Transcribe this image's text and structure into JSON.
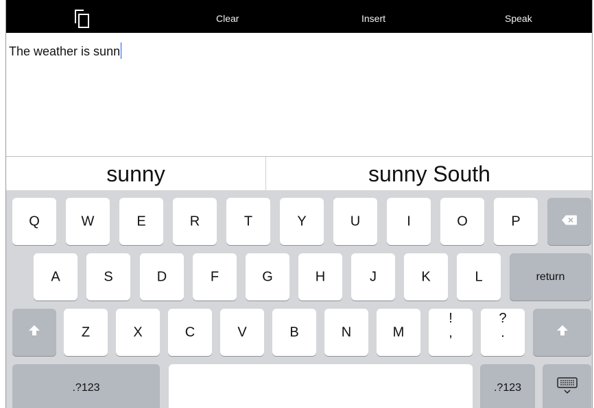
{
  "toolbar": {
    "copy_icon": "copy-icon",
    "clear_label": "Clear",
    "insert_label": "Insert",
    "speak_label": "Speak"
  },
  "editor": {
    "text": "The weather is sunn"
  },
  "suggestions": [
    "sunny",
    "sunny South"
  ],
  "keyboard": {
    "row1": [
      "Q",
      "W",
      "E",
      "R",
      "T",
      "Y",
      "U",
      "I",
      "O",
      "P"
    ],
    "row2": [
      "A",
      "S",
      "D",
      "F",
      "G",
      "H",
      "J",
      "K",
      "L"
    ],
    "row3": [
      "Z",
      "X",
      "C",
      "V",
      "B",
      "N",
      "M"
    ],
    "punct1": {
      "top": "!",
      "bottom": ","
    },
    "punct2": {
      "top": "?",
      "bottom": "."
    },
    "return_label": "return",
    "numbers_left": ".?123",
    "numbers_right": ".?123",
    "backspace_icon": "backspace-icon",
    "shift_icon": "shift-icon",
    "hide_keyboard_icon": "hide-keyboard-icon"
  }
}
